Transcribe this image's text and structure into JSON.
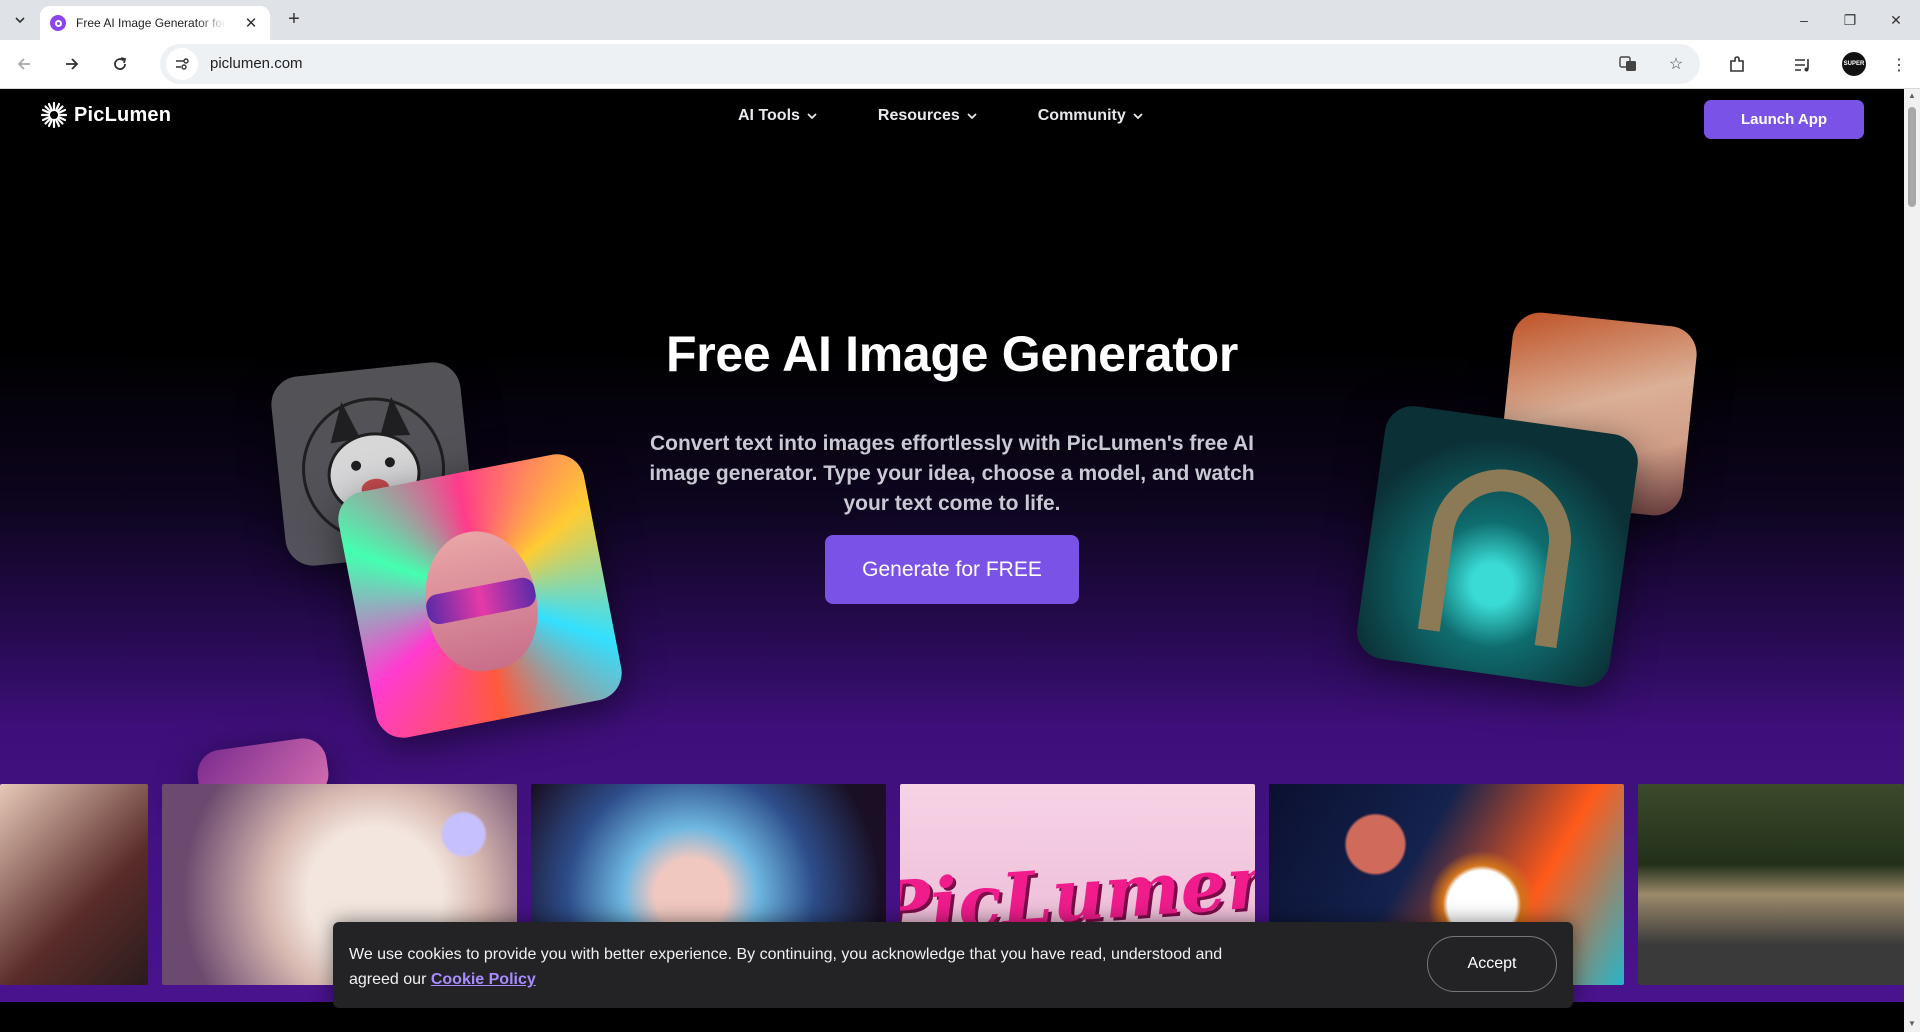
{
  "browser": {
    "tab_title": "Free AI Image Generator for",
    "url": "piclumen.com",
    "profile_label": "SUPER"
  },
  "site": {
    "logo_text": "PicLumen",
    "nav": [
      {
        "label": "AI Tools"
      },
      {
        "label": "Resources"
      },
      {
        "label": "Community"
      }
    ],
    "launch_label": "Launch App"
  },
  "hero": {
    "title": "Free AI Image Generator",
    "subtitle": "Convert text into images effortlessly with PicLumen's free AI image generator. Type your idea, choose a model, and watch your text come to life.",
    "cta_label": "Generate for FREE"
  },
  "gallery": {
    "logo_tile_text": "PicLumen"
  },
  "cookie": {
    "text": "We use cookies to provide you with better experience. By continuing, you acknowledge that you have read, understood and agreed our ",
    "link_label": "Cookie Policy",
    "accept_label": "Accept"
  },
  "colors": {
    "accent": "#7b52e6",
    "link": "#a98bff",
    "banner_bg": "#232326"
  }
}
